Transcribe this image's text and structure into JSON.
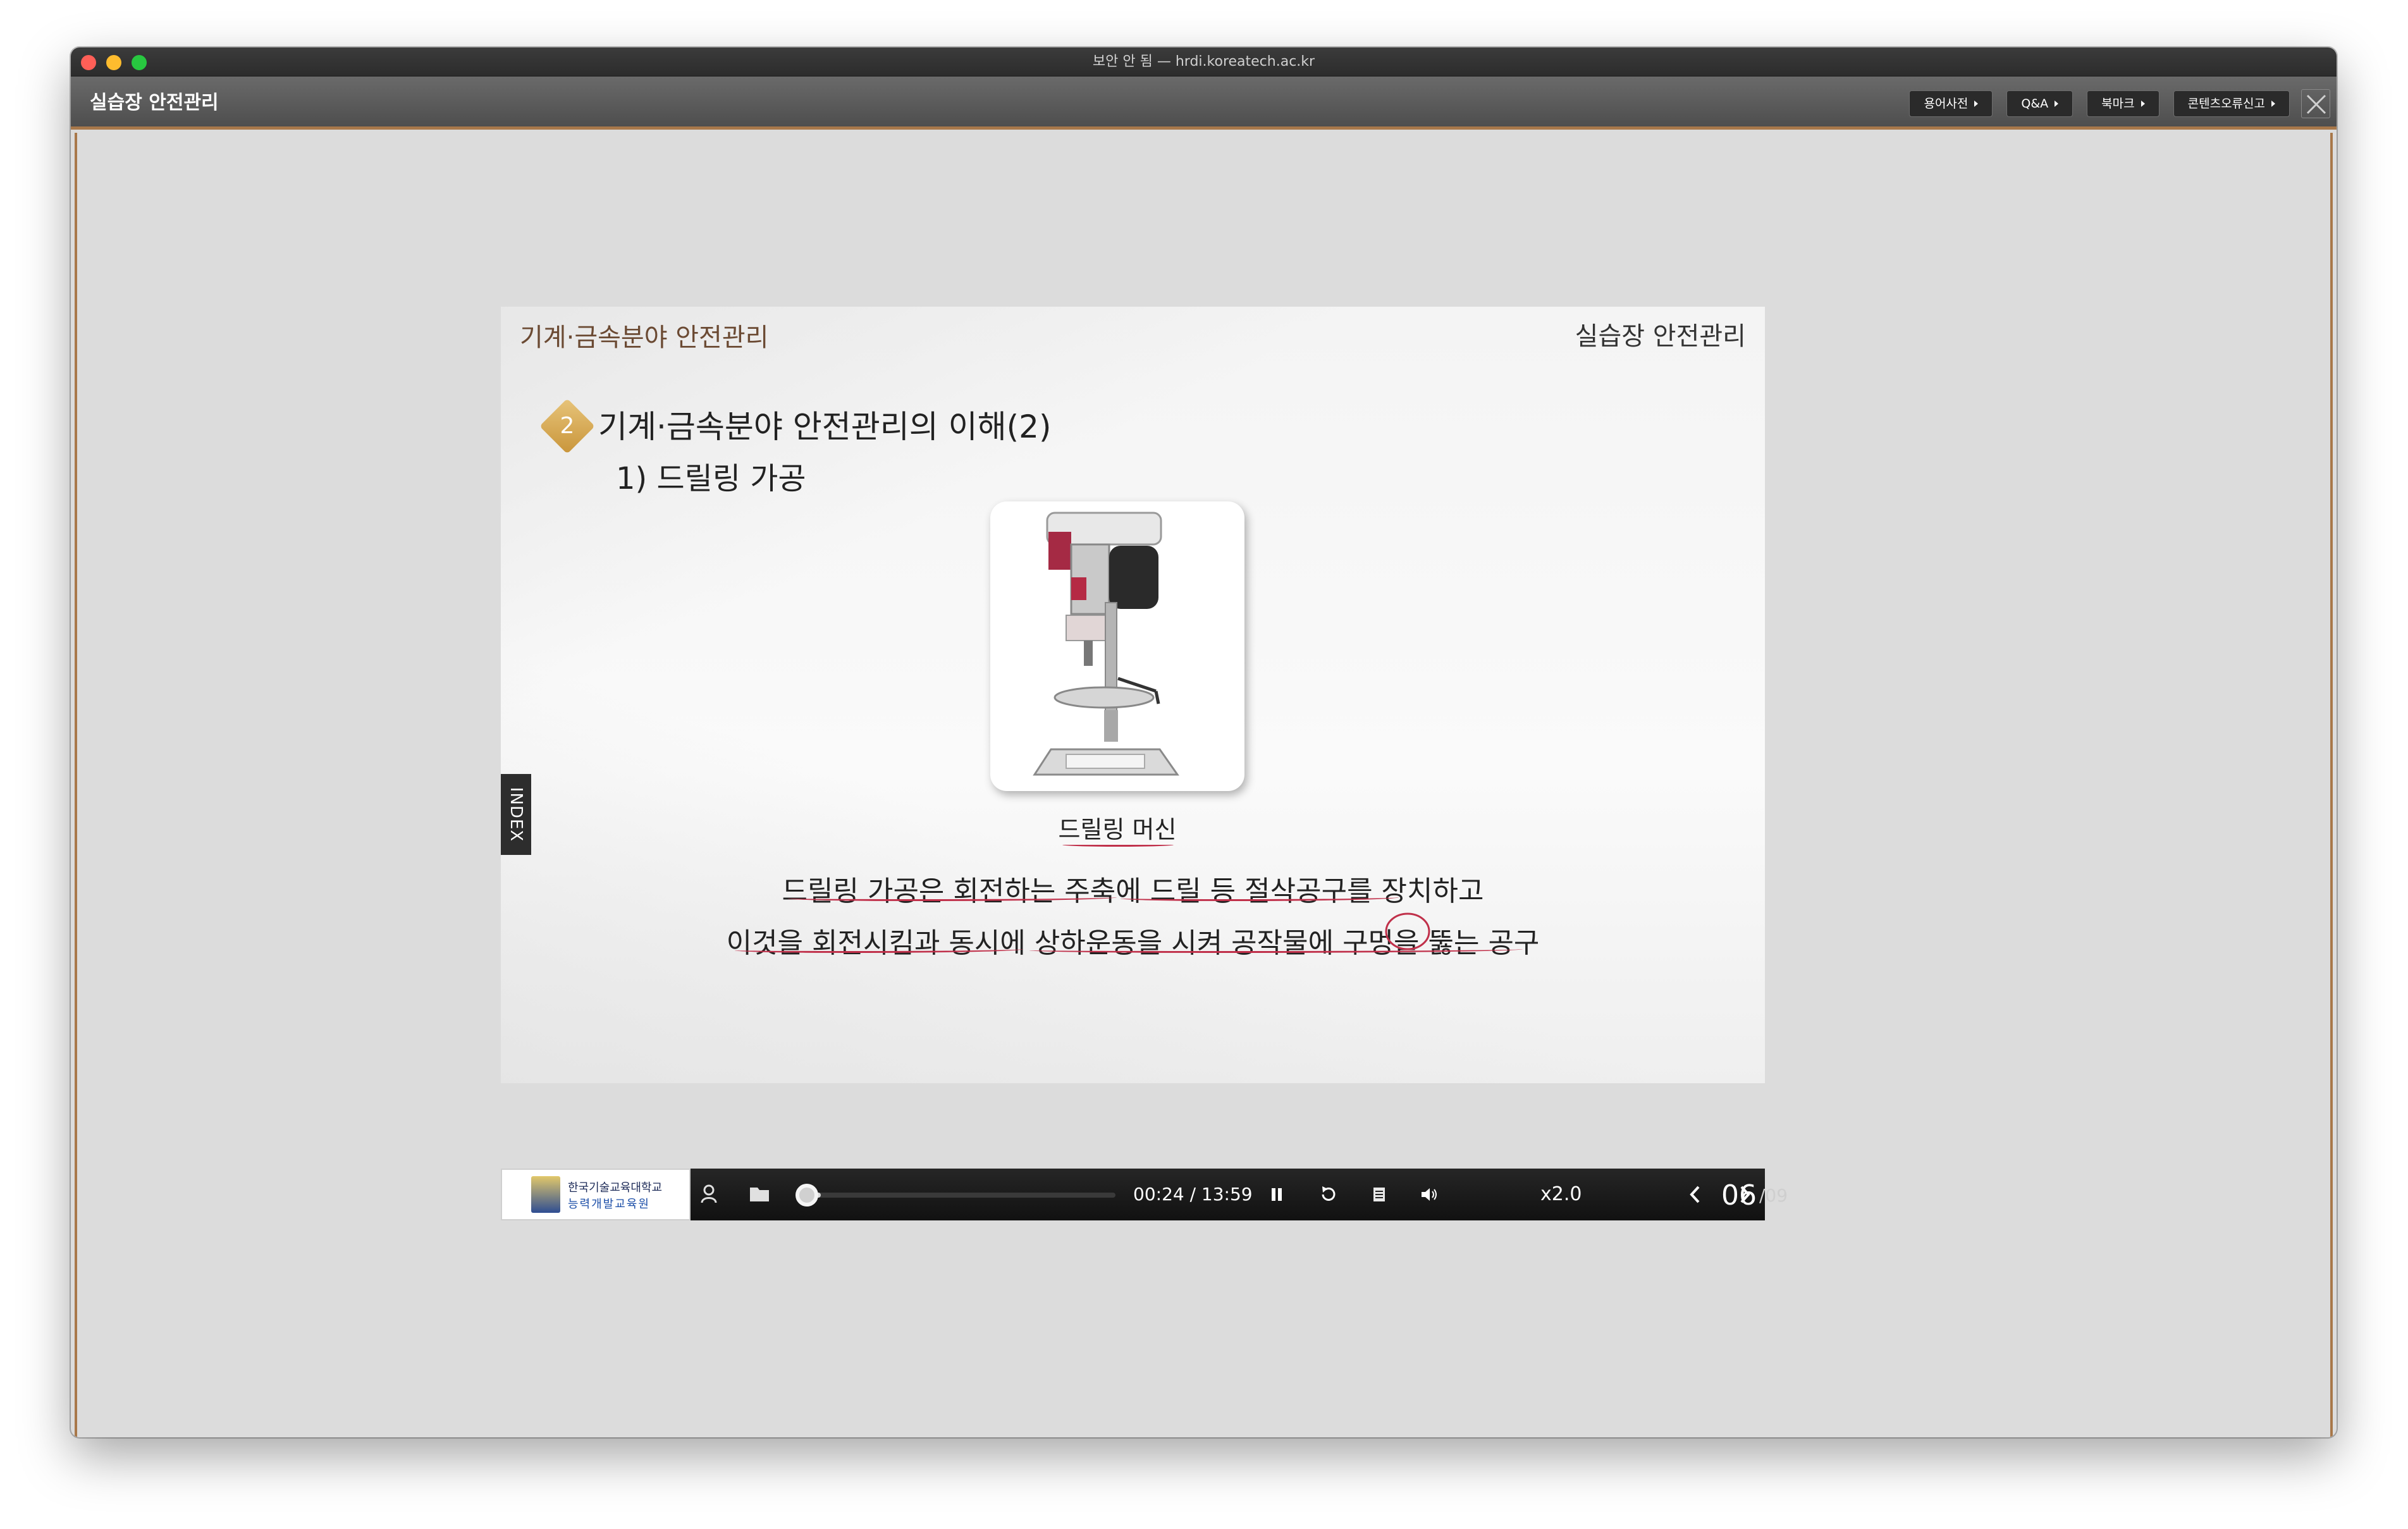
{
  "browser": {
    "url_text": "보안 안 됨 — hrdi.koreatech.ac.kr"
  },
  "app": {
    "title": "실습장 안전관리",
    "toolbar_buttons": [
      "용어사전",
      "Q&A",
      "북마크",
      "콘텐츠오류신고"
    ]
  },
  "slide": {
    "header_left": "기계·금속분야 안전관리",
    "header_right": "실습장 안전관리",
    "section_number": "2",
    "section_title": "기계·금속분야 안전관리의 이해(2)",
    "sub_title": "1) 드릴링 가공",
    "image_caption": "드릴링 머신",
    "body_line1": "드릴링 가공은 회전하는 주축에 드릴 등 절삭공구를 장치하고",
    "body_line2": "이것을 회전시킴과 동시에 상하운동을 시켜 공작물에 구멍을 뚫는 공구",
    "index_tab": "INDEX"
  },
  "player": {
    "logo_line1": "한국기술교육대학교",
    "logo_line2": "능력개발교육원",
    "time": "00:24 / 13:59",
    "progress": 0.029,
    "speed": "x2.0",
    "page_current": "06",
    "page_total": "/09",
    "icons": [
      "user-icon",
      "folder-icon",
      "pause-icon",
      "replay-icon",
      "list-icon",
      "volume-icon",
      "prev-page-icon",
      "next-page-icon"
    ]
  },
  "colors": {
    "accent_border": "#a8784a",
    "underline_red": "#c0304a",
    "badge_gold": "#d4a24c"
  }
}
